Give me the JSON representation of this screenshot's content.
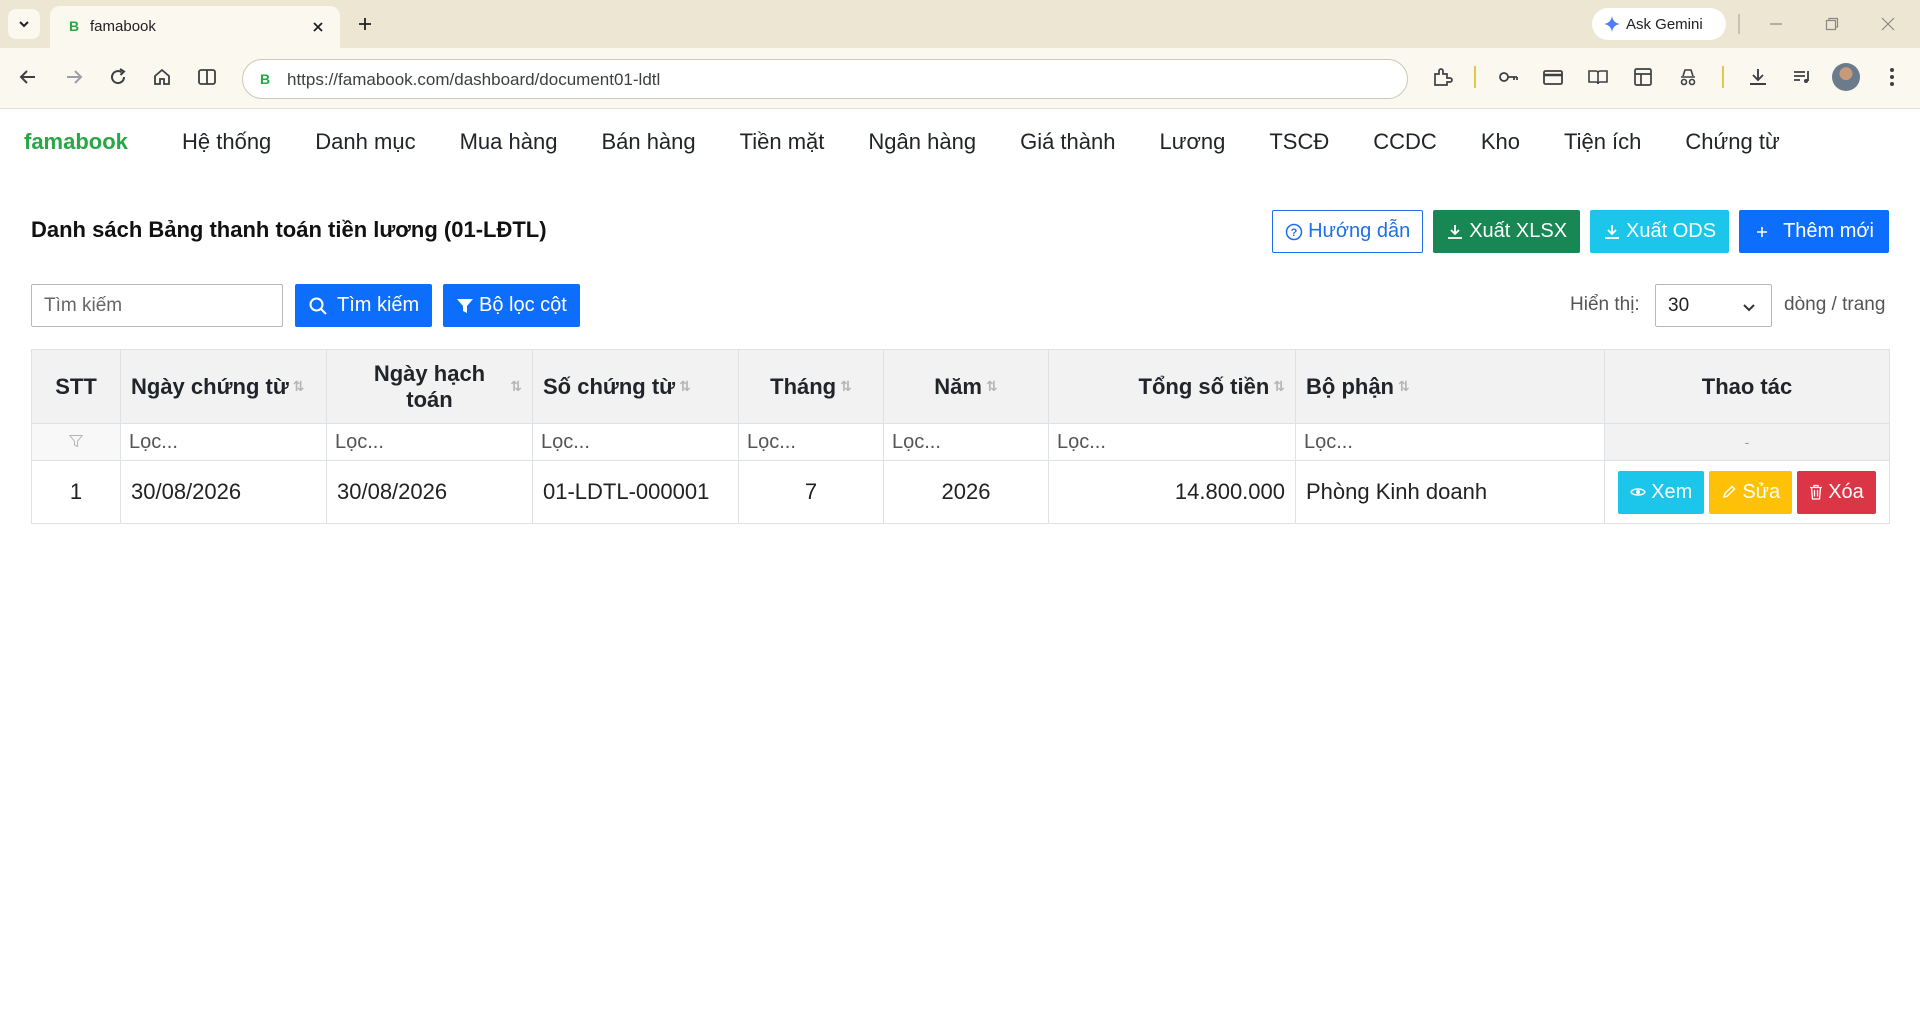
{
  "browser": {
    "tab_title": "famabook",
    "url": "https://famabook.com/dashboard/document01-ldtl",
    "gemini_label": "Ask Gemini"
  },
  "nav": {
    "brand": "famabook",
    "items": [
      "Hệ thống",
      "Danh mục",
      "Mua hàng",
      "Bán hàng",
      "Tiền mặt",
      "Ngân hàng",
      "Giá thành",
      "Lương",
      "TSCĐ",
      "CCDC",
      "Kho",
      "Tiện ích",
      "Chứng từ"
    ]
  },
  "page": {
    "title": "Danh sách Bảng thanh toán tiền lương (01-LĐTL)",
    "actions": {
      "guide": "Hướng dẫn",
      "export_xlsx": "Xuất XLSX",
      "export_ods": "Xuất ODS",
      "add_new": "Thêm mới"
    }
  },
  "search": {
    "placeholder": "Tìm kiếm",
    "button": "Tìm kiếm",
    "column_filter": "Bộ lọc cột",
    "show_label": "Hiển thị:",
    "page_size": "30",
    "rows_label": "dòng / trang"
  },
  "table": {
    "headers": {
      "stt": "STT",
      "doc_date": "Ngày chứng từ",
      "post_date": "Ngày hạch toán",
      "doc_no": "Số chứng từ",
      "month": "Tháng",
      "year": "Năm",
      "total": "Tổng số tiền",
      "department": "Bộ phận",
      "actions": "Thao tác"
    },
    "filter_placeholder": "Lọc...",
    "actions_filter": "-",
    "rows": [
      {
        "stt": "1",
        "doc_date": "30/08/2026",
        "post_date": "30/08/2026",
        "doc_no": "01-LDTL-000001",
        "month": "7",
        "year": "2026",
        "total": "14.800.000",
        "department": "Phòng Kinh doanh"
      }
    ],
    "row_actions": {
      "view": "Xem",
      "edit": "Sửa",
      "delete": "Xóa"
    }
  },
  "colors": {
    "brand": "#28a745",
    "primary": "#0d6efd",
    "success": "#198754",
    "info": "#1bc6ea",
    "warning": "#ffc107",
    "danger": "#dc3545"
  }
}
